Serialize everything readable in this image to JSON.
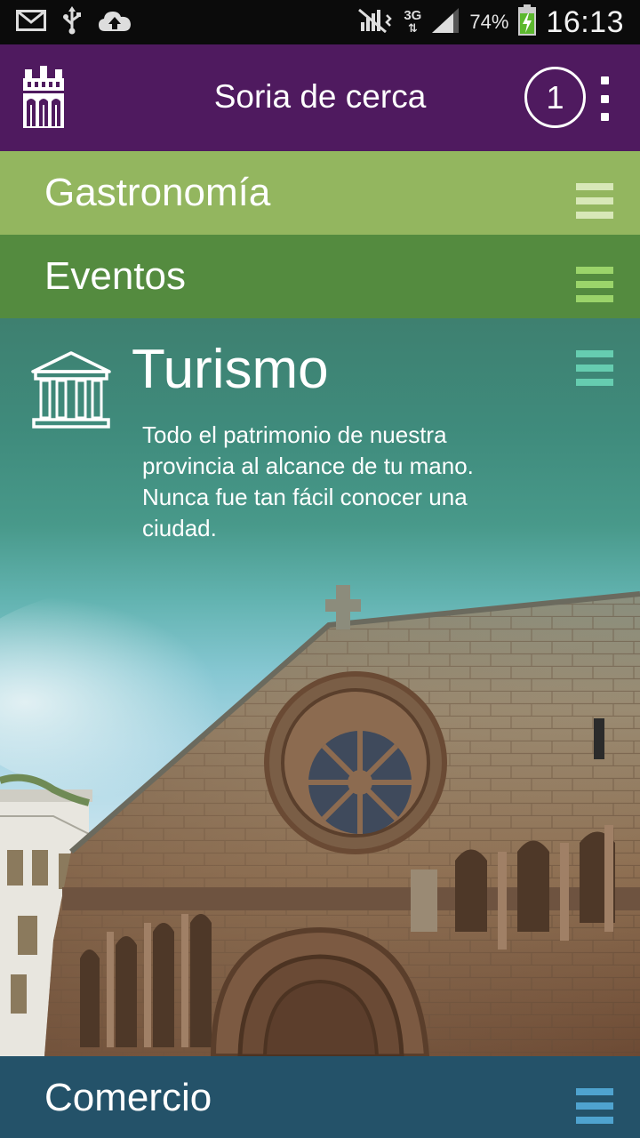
{
  "status_bar": {
    "battery_percent": "74%",
    "time": "16:13",
    "network_type": "3G",
    "icons": [
      "mail-icon",
      "usb-icon",
      "cloud-upload-icon",
      "signal-muted-icon",
      "network-3g-icon",
      "cell-signal-icon",
      "battery-charging-icon"
    ]
  },
  "app_bar": {
    "title": "Soria de cerca",
    "notification_count": "1",
    "logo_icon": "soria-logo-icon",
    "overflow_icon": "more-vert-icon"
  },
  "categories": [
    {
      "label": "Gastronomía",
      "color": "#93b65f",
      "menu_icon": "menu-icon"
    },
    {
      "label": "Eventos",
      "color": "#548b3f",
      "menu_icon": "menu-icon"
    },
    {
      "label": "Turismo",
      "color": "#3e8070",
      "icon": "temple-icon",
      "menu_icon": "menu-icon",
      "description": "Todo el patrimonio de nuestra provincia al alcance de tu mano. Nunca fue tan fácil conocer una ciudad.",
      "expanded": true
    },
    {
      "label": "Comercio",
      "color": "#245269",
      "menu_icon": "menu-icon"
    }
  ],
  "colors": {
    "app_bar": "#4f1a5f",
    "status_bar": "#0b0b0b"
  }
}
